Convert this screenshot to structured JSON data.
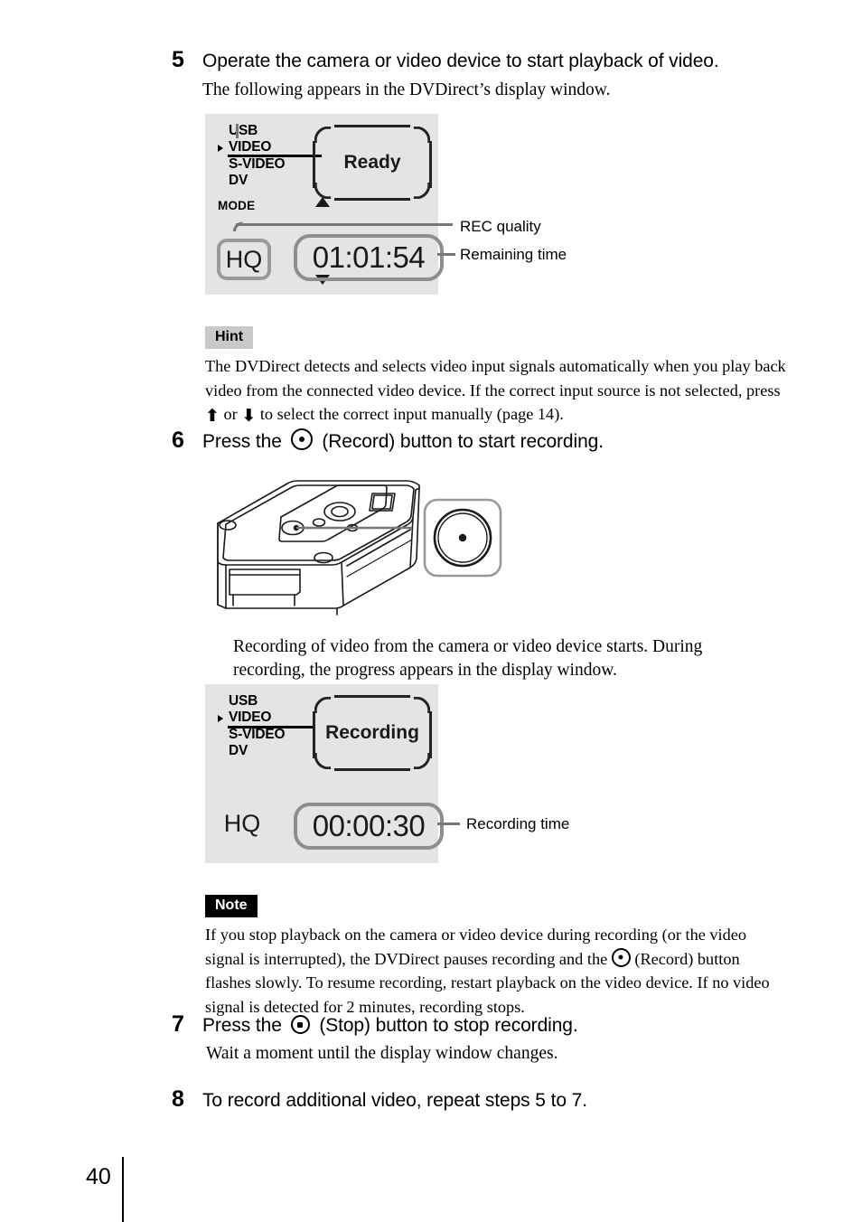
{
  "page": {
    "number": "40"
  },
  "steps": [
    {
      "num": "5",
      "title_a": "Operate the camera or video device to start playback of video.",
      "body": "The following appears in the DVDirect’s display window."
    },
    {
      "num": "6",
      "title_a": "Press the",
      "title_b": "(Record) button to start recording.",
      "icon": "record-icon",
      "body": "Recording of video from the camera or video device starts. During recording, the progress appears in the display window."
    },
    {
      "num": "7",
      "title_a": "Press the",
      "title_b": "(Stop) button to stop recording.",
      "icon": "stop-icon",
      "body": "Wait a moment until the display window changes."
    },
    {
      "num": "8",
      "title_a": "To record additional video, repeat steps 5 to 7."
    }
  ],
  "display_ready": {
    "sources": [
      {
        "label": "USB",
        "selected": false
      },
      {
        "label": "VIDEO",
        "selected": true
      },
      {
        "label": "S-VIDEO",
        "selected": false
      },
      {
        "label": "DV",
        "selected": false
      }
    ],
    "mode_label": "MODE",
    "status": "Ready",
    "quality": "HQ",
    "time": "01:01:54",
    "callout_quality": "REC quality",
    "callout_time": "Remaining time"
  },
  "display_recording": {
    "sources": [
      {
        "label": "USB",
        "selected": false
      },
      {
        "label": "VIDEO",
        "selected": true
      },
      {
        "label": "S-VIDEO",
        "selected": false
      },
      {
        "label": "DV",
        "selected": false
      }
    ],
    "status": "Recording",
    "quality": "HQ",
    "time": "00:00:30",
    "callout_time": "Recording time"
  },
  "hint": {
    "badge": "Hint",
    "text_1": "The DVDirect detects and selects video input signals automatically when you play back video from the connected video device. If the correct input source is not selected, press",
    "arrow_up": "⬆",
    "text_or": "or",
    "arrow_down": "⬇",
    "text_2": "to select the correct input manually (page 14)."
  },
  "note": {
    "badge": "Note",
    "text_1": "If you stop playback on the camera or video device during recording (or the video signal is interrupted), the DVDirect pauses recording and the",
    "text_2": "(Record) button flashes slowly. To resume recording, restart playback on the video device. If no video signal is detected for 2 minutes, recording stops."
  }
}
